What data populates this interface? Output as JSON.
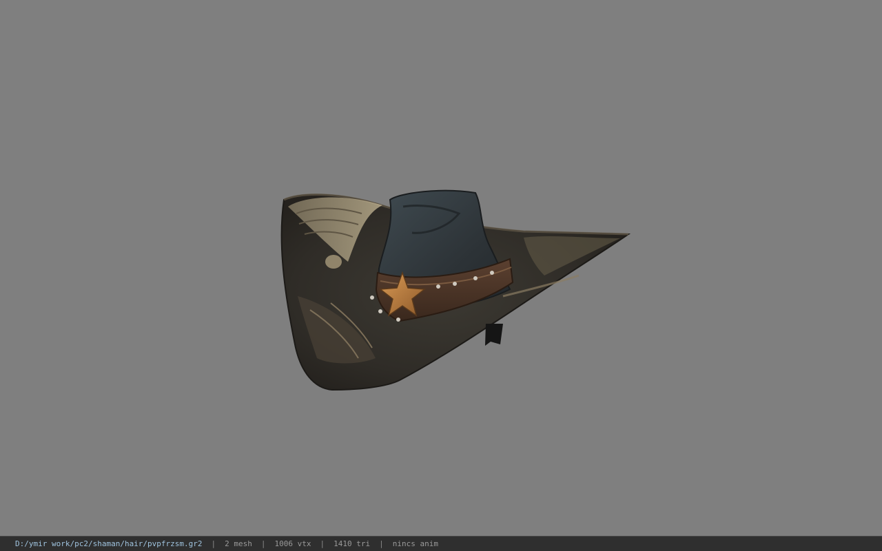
{
  "viewport": {
    "background": "#7f7f7f",
    "model": "cowboy-hat"
  },
  "statusbar": {
    "file_path": "D:/ymir work/pc2/shaman/hair/pvpfrzsm.gr2",
    "separator": "|",
    "mesh": "2 mesh",
    "vertices": "1006 vtx",
    "triangles": "1410 tri",
    "anim": "nincs anim"
  }
}
